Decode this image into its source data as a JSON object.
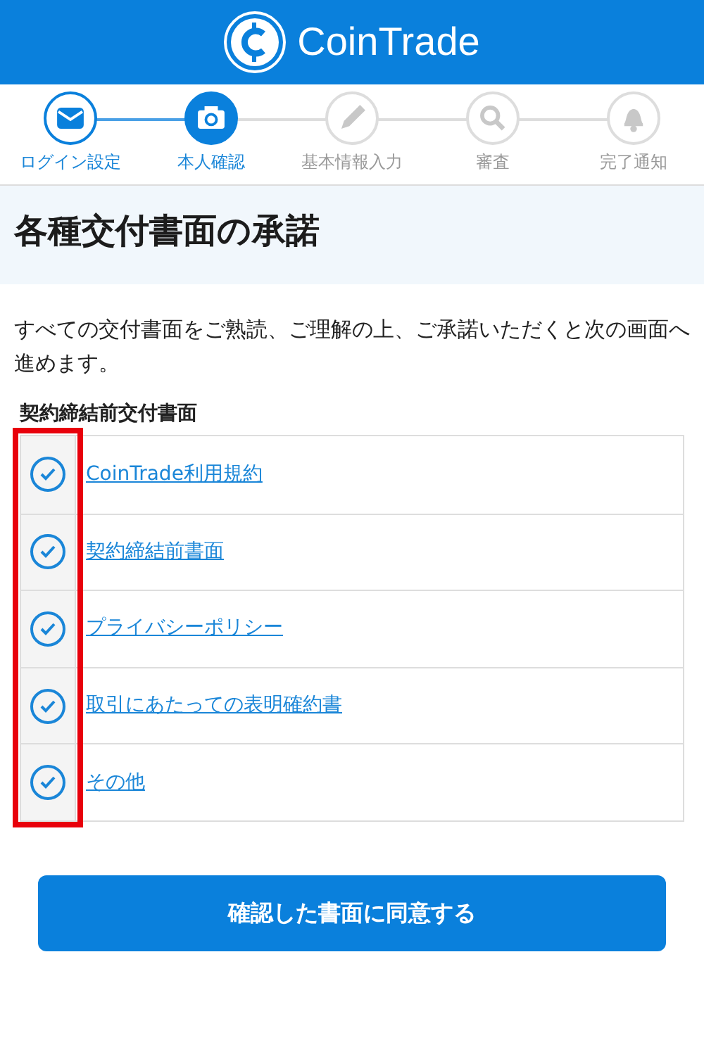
{
  "header": {
    "brand": "CoinTrade"
  },
  "steps": [
    {
      "label": "ログイン設定",
      "completed": true,
      "selected": false
    },
    {
      "label": "本人確認",
      "completed": false,
      "selected": true
    },
    {
      "label": "基本情報入力",
      "completed": false,
      "selected": false
    },
    {
      "label": "審査",
      "completed": false,
      "selected": false
    },
    {
      "label": "完了通知",
      "completed": false,
      "selected": false
    }
  ],
  "title": "各種交付書面の承諾",
  "intro": "すべての交付書面をご熟読、ご理解の上、ご承諾いただくと次の画面へ進めます。",
  "section_label": "契約締結前交付書面",
  "check_column_highlighted": true,
  "documents": [
    {
      "label": "CoinTrade利用規約",
      "checked": true
    },
    {
      "label": "契約締結前書面",
      "checked": true
    },
    {
      "label": "プライバシーポリシー",
      "checked": true
    },
    {
      "label": "取引にあたっての表明確約書",
      "checked": true
    },
    {
      "label": "その他",
      "checked": true
    }
  ],
  "button": "確認した書面に同意する"
}
